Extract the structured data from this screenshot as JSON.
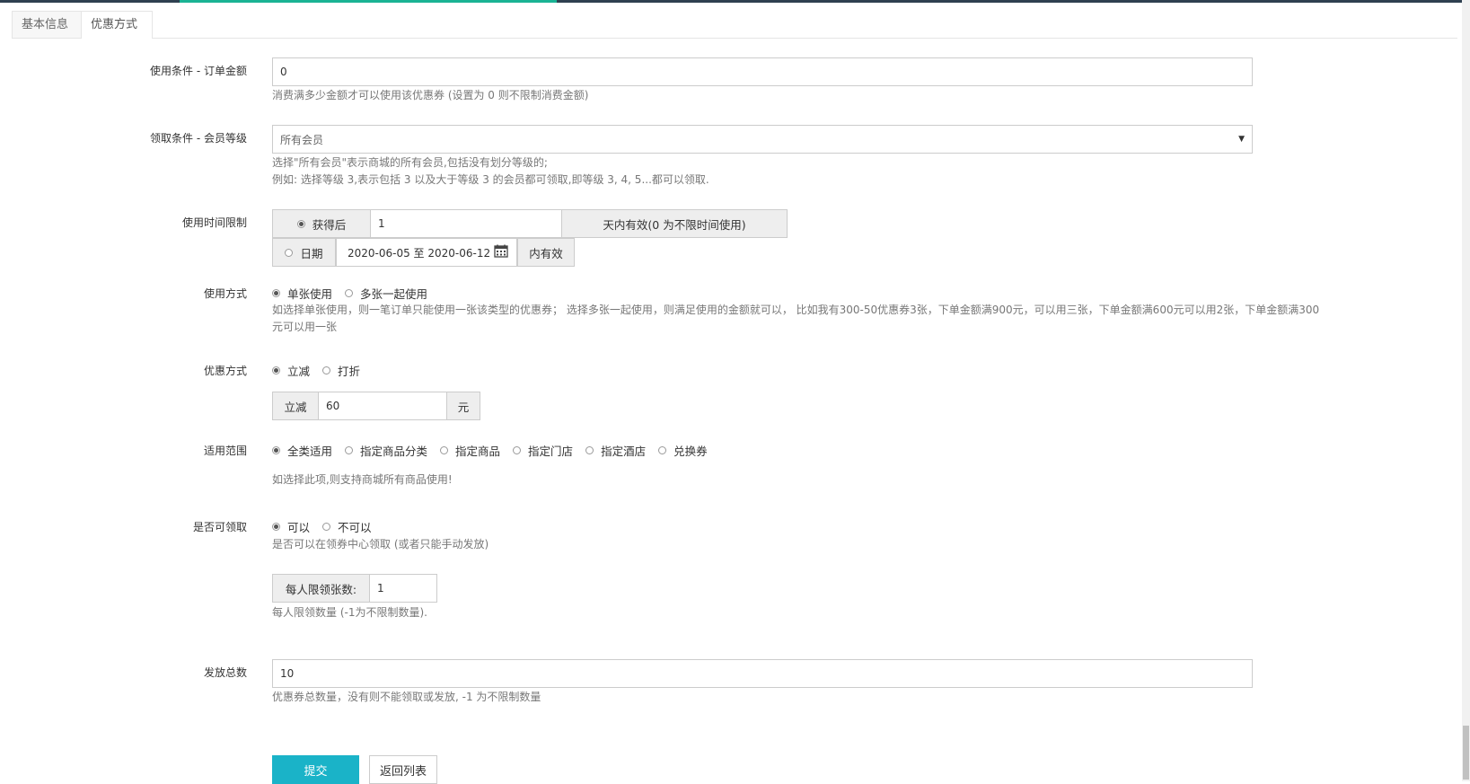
{
  "tabs": [
    {
      "label": "基本信息"
    },
    {
      "label": "优惠方式"
    }
  ],
  "order_amount": {
    "label": "使用条件 - 订单金额",
    "value": "0",
    "help": "消费满多少金额才可以使用该优惠券 (设置为 0 则不限制消费金额)"
  },
  "member_level": {
    "label": "领取条件 - 会员等级",
    "selected": "所有会员",
    "help1": "选择\"所有会员\"表示商城的所有会员,包括没有划分等级的;",
    "help2": "例如: 选择等级 3,表示包括 3 以及大于等级 3 的会员都可领取,即等级 3, 4, 5...都可以领取."
  },
  "time_limit": {
    "label": "使用时间限制",
    "after_label": "获得后",
    "days_value": "1",
    "days_suffix": "天内有效(0 为不限时间使用)",
    "date_label": "日期",
    "date_range": "2020-06-05 至 2020-06-12",
    "date_suffix": "内有效"
  },
  "usage_mode": {
    "label": "使用方式",
    "options": [
      "单张使用",
      "多张一起使用"
    ],
    "help1": "如选择单张使用，则一笔订单只能使用一张该类型的优惠券； 选择多张一起使用，则满足使用的金额就可以， 比如我有300-50优惠券3张，下单金额满900元，可以用三张，下单金额满600元可以用2张，下单金额满300",
    "help2": "元可以用一张"
  },
  "discount_mode": {
    "label": "优惠方式",
    "options": [
      "立减",
      "打折"
    ],
    "prefix": "立减",
    "value": "60",
    "suffix": "元"
  },
  "scope": {
    "label": "适用范围",
    "options": [
      "全类适用",
      "指定商品分类",
      "指定商品",
      "指定门店",
      "指定酒店",
      "兑换券"
    ],
    "help": "如选择此项,则支持商城所有商品使用!"
  },
  "claimable": {
    "label": "是否可领取",
    "options": [
      "可以",
      "不可以"
    ],
    "help": "是否可以在领券中心领取 (或者只能手动发放)",
    "limit_label": "每人限领张数:",
    "limit_value": "1",
    "limit_help": "每人限领数量 (-1为不限制数量)."
  },
  "total": {
    "label": "发放总数",
    "value": "10",
    "help": "优惠券总数量，没有则不能领取或发放, -1 为不限制数量"
  },
  "buttons": {
    "submit": "提交",
    "back": "返回列表"
  },
  "colors": {
    "primary": "#1ab3c8",
    "topbar": "#2f4050",
    "topbar_accent": "#1ab394"
  }
}
